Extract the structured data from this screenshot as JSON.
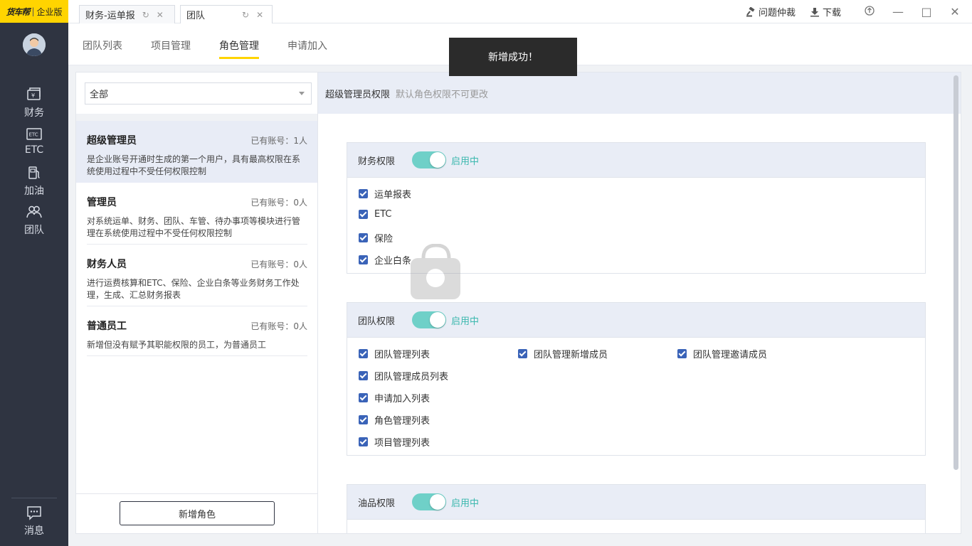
{
  "brand": {
    "logo": "货车帮",
    "edition": "企业版"
  },
  "sidebar": {
    "items": [
      {
        "label": "财务",
        "icon": "finance-icon"
      },
      {
        "label": "ETC",
        "icon": "etc-icon"
      },
      {
        "label": "加油",
        "icon": "fuel-icon"
      },
      {
        "label": "团队",
        "icon": "team-icon"
      }
    ],
    "bottom": {
      "label": "消息",
      "icon": "message-icon"
    }
  },
  "tabs": [
    {
      "label": "财务-运单报",
      "active": false
    },
    {
      "label": "团队",
      "active": true
    }
  ],
  "top_actions": {
    "arbitration": "问题仲裁",
    "download": "下载"
  },
  "subnav": [
    {
      "label": "团队列表",
      "active": false
    },
    {
      "label": "项目管理",
      "active": false
    },
    {
      "label": "角色管理",
      "active": true
    },
    {
      "label": "申请加入",
      "active": false
    }
  ],
  "toast": "新增成功！",
  "filter": {
    "value": "全部"
  },
  "roles": [
    {
      "name": "超级管理员",
      "count": "已有账号：1人",
      "desc": "是企业账号开通时生成的第一个用户，具有最高权限在系统使用过程中不受任何权限控制",
      "active": true
    },
    {
      "name": "管理员",
      "count": "已有账号：0人",
      "desc": "对系统运单、财务、团队、车管、待办事项等模块进行管理在系统使用过程中不受任何权限控制",
      "active": false
    },
    {
      "name": "财务人员",
      "count": "已有账号：0人",
      "desc": "进行运费核算和ETC、保险、企业白条等业务财务工作处理，生成、汇总财务报表",
      "active": false
    },
    {
      "name": "普通员工",
      "count": "已有账号：0人",
      "desc": "新增但没有赋予其职能权限的员工，为普通员工",
      "active": false
    }
  ],
  "add_role_button": "新增角色",
  "detail": {
    "title": "超级管理员权限",
    "subtitle": "默认角色权限不可更改",
    "sections": [
      {
        "title": "财务权限",
        "status": "启用中",
        "items": [
          "运单报表",
          "ETC",
          "保险",
          "企业白条"
        ]
      },
      {
        "title": "团队权限",
        "status": "启用中",
        "items": [
          "团队管理列表",
          "团队管理新增成员",
          "团队管理邀请成员",
          "团队管理成员列表",
          "申请加入列表",
          "角色管理列表",
          "项目管理列表"
        ]
      },
      {
        "title": "油品权限",
        "status": "启用中",
        "items": []
      }
    ]
  },
  "colors": {
    "accent": "#ffd400",
    "sidebar": "#2f3441",
    "toggle_on": "#6fd0c8",
    "checkbox": "#3a63b8"
  }
}
